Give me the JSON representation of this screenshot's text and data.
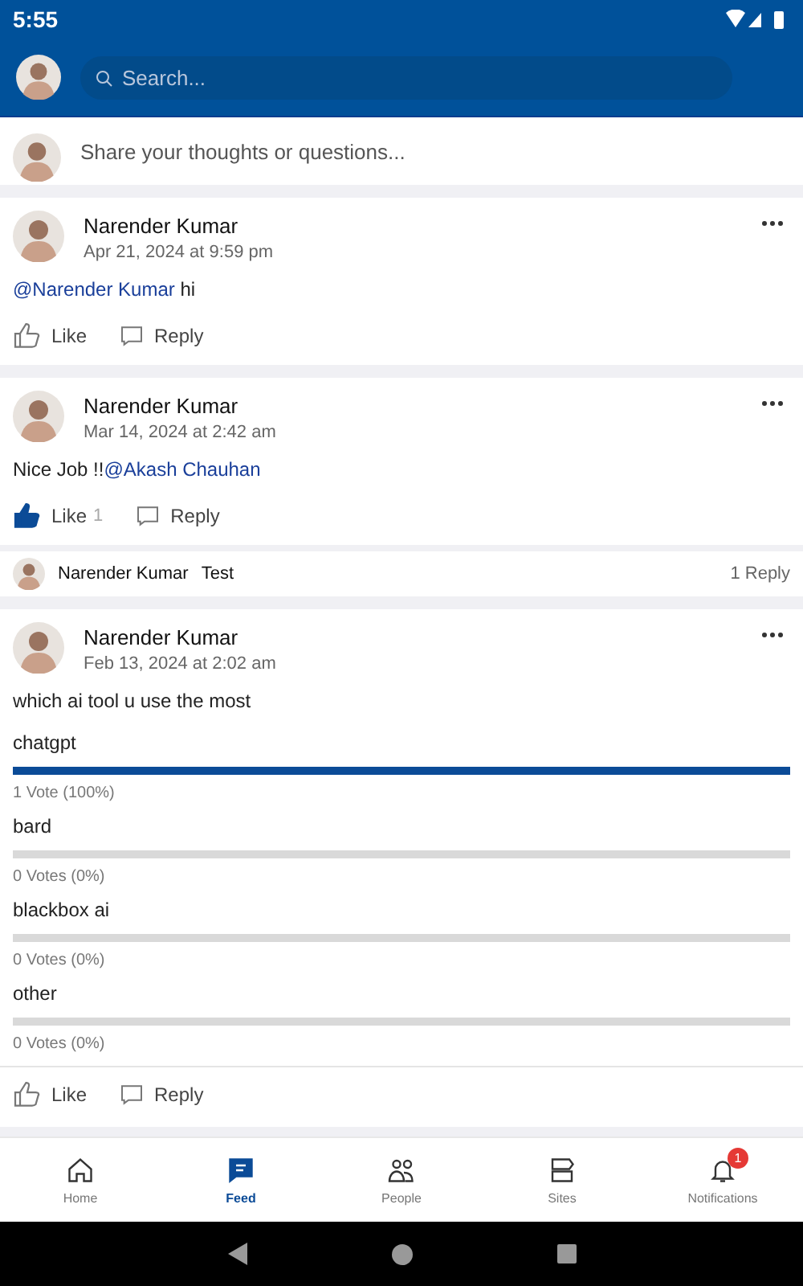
{
  "status_bar": {
    "time": "5:55"
  },
  "search": {
    "placeholder": "Search..."
  },
  "composer": {
    "placeholder": "Share your thoughts or questions..."
  },
  "posts": [
    {
      "kind": "text",
      "author": "Narender Kumar",
      "date": "Apr 21, 2024 at 9:59 pm",
      "body": [
        {
          "kind": "mention",
          "text": "@Narender Kumar"
        },
        {
          "kind": "plain",
          "text": " hi"
        }
      ],
      "like": {
        "label": "Like",
        "liked": false
      },
      "reply": "Reply"
    },
    {
      "kind": "text",
      "author": "Narender Kumar",
      "date": "Mar 14, 2024 at 2:42 am",
      "body": [
        {
          "kind": "plain",
          "text": "Nice Job !!"
        },
        {
          "kind": "mention",
          "text": "@Akash Chauhan"
        }
      ],
      "like": {
        "label": "Like",
        "liked": true,
        "count": "1"
      },
      "reply": "Reply",
      "comment": {
        "author": "Narender Kumar",
        "text": "Test",
        "replies": "1 Reply"
      }
    },
    {
      "kind": "poll",
      "author": "Narender Kumar",
      "date": "Feb 13, 2024 at 2:02 am",
      "question": "which ai tool u use the most",
      "options": [
        {
          "label": "chatgpt",
          "level": 1,
          "votes": "1 Vote (100%)"
        },
        {
          "label": "bard",
          "votes": "0 Votes (0%)"
        },
        {
          "label": "blackbox ai",
          "votes": "0 Votes (0%)"
        },
        {
          "label": "other",
          "votes": "0 Votes (0%)"
        }
      ],
      "like": {
        "label": "Like",
        "liked": false
      },
      "reply": "Reply"
    }
  ],
  "nav": [
    {
      "label": "Home",
      "kind": "home",
      "selected": false
    },
    {
      "label": "Feed",
      "kind": "feed",
      "selected": true
    },
    {
      "label": "People",
      "kind": "people",
      "selected": false
    },
    {
      "label": "Sites",
      "kind": "sites",
      "selected": false
    },
    {
      "label": "Notifications",
      "kind": "bell",
      "selected": false,
      "badge": "1"
    }
  ]
}
